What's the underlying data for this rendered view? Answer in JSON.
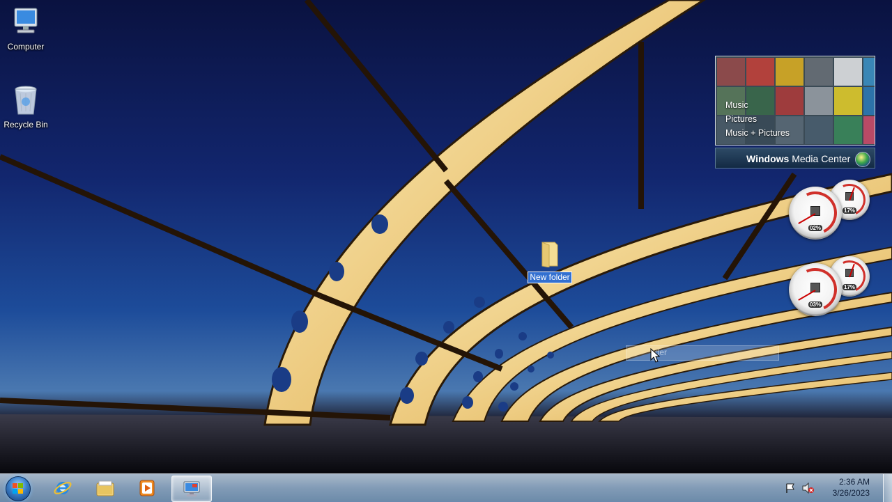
{
  "desktop": {
    "icons": [
      {
        "label": "Computer",
        "icon": "computer-icon"
      },
      {
        "label": "Recycle Bin",
        "icon": "recycle-bin-icon"
      }
    ],
    "new_folder": {
      "label": "New folder",
      "icon": "folder-icon",
      "state": "renaming"
    },
    "drag_ghost": {
      "label": "ider"
    }
  },
  "gadgets": {
    "media_center": {
      "menu": [
        "Music",
        "Pictures",
        "Music + Pictures"
      ],
      "brand_bold": "Windows",
      "brand_rest": " Media Center",
      "icon": "windows-orb-icon"
    },
    "cpu_meters": [
      {
        "cpu_label": "02%",
        "mem_label": "17%"
      },
      {
        "cpu_label": "03%",
        "mem_label": "17%"
      }
    ]
  },
  "taskbar": {
    "start": {
      "icon": "windows-start-icon"
    },
    "pinned": [
      {
        "name": "internet-explorer",
        "icon": "internet-explorer-icon"
      },
      {
        "name": "windows-explorer",
        "icon": "folder-library-icon"
      },
      {
        "name": "media-player",
        "icon": "media-player-icon"
      },
      {
        "name": "remote-desktop",
        "icon": "remote-desktop-icon",
        "active": true
      }
    ],
    "tray": {
      "icons": [
        "action-center-flag-icon",
        "volume-muted-icon"
      ],
      "time": "2:36 AM",
      "date": "3/26/2023"
    }
  },
  "colors": {
    "sky_top": "#0a1240",
    "sky_mid": "#1d4c9a",
    "structure": "#f2d48a",
    "selection": "#3370d0"
  }
}
